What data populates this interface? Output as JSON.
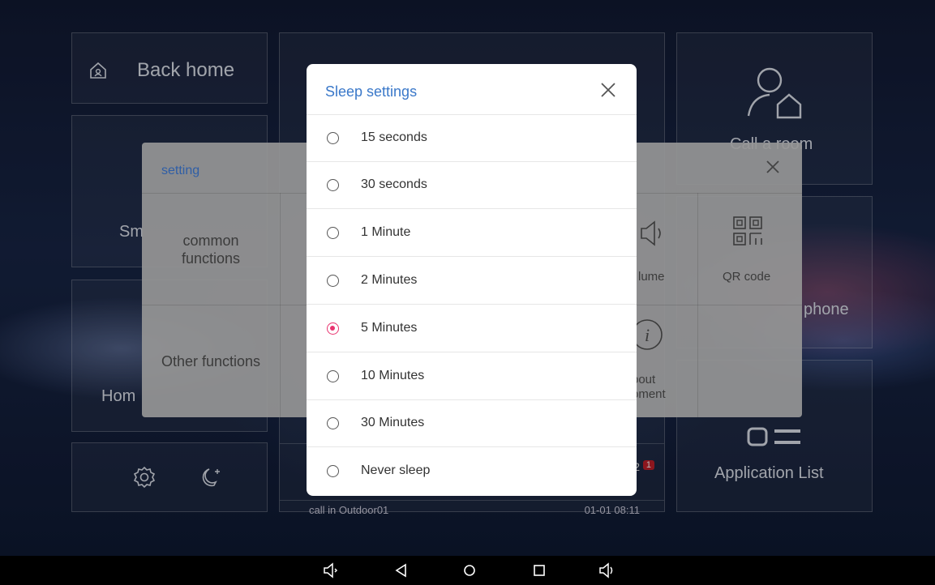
{
  "background_tiles": {
    "back_home": "Back home",
    "smart_partial": "Sm",
    "home_partial": "Hom",
    "call_room_partial": "Call a room",
    "phone_partial": "phone",
    "app_list": "Application List",
    "list_row_text": "call in Outdoor01",
    "list_row_time": "01-01 08:11",
    "list_row_badge": "1",
    "list_row_count": "2"
  },
  "settings_panel": {
    "title": "setting",
    "side_common": "common functions",
    "side_other": "Other functions",
    "item_volume_partial": "lume",
    "item_qr": "QR code",
    "item_about_partial": "bout\npment"
  },
  "sleep_dialog": {
    "title": "Sleep settings",
    "options": [
      {
        "label": "15 seconds",
        "selected": false
      },
      {
        "label": "30 seconds",
        "selected": false
      },
      {
        "label": "1 Minute",
        "selected": false
      },
      {
        "label": "2 Minutes",
        "selected": false
      },
      {
        "label": "5 Minutes",
        "selected": true
      },
      {
        "label": "10 Minutes",
        "selected": false
      },
      {
        "label": "30 Minutes",
        "selected": false
      },
      {
        "label": "Never sleep",
        "selected": false
      }
    ],
    "accent_color": "#e9336f",
    "title_color": "#3a78c9"
  },
  "navbar": {
    "icons": [
      "volume-down-icon",
      "back-icon",
      "home-icon",
      "recents-icon",
      "volume-up-icon"
    ]
  }
}
